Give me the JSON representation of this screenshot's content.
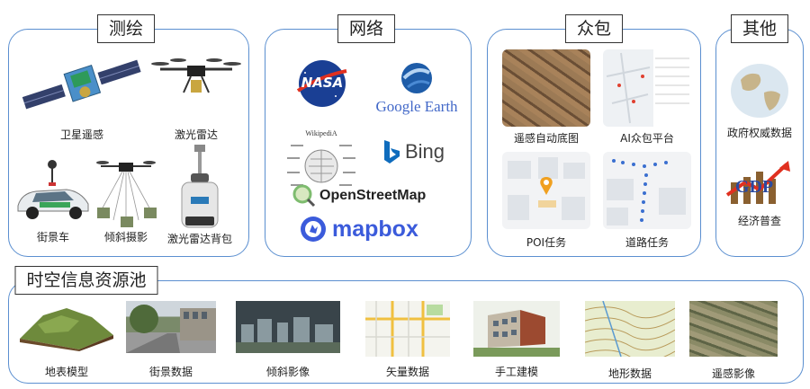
{
  "sections": {
    "survey": {
      "title": "测绘",
      "items": [
        "卫星遥感",
        "激光雷达",
        "街景车",
        "倾斜摄影",
        "激光雷达背包"
      ]
    },
    "network": {
      "title": "网络",
      "logos": {
        "nasa": "NASA",
        "google_earth": "Google Earth",
        "wikipedia": "WikipediA",
        "bing": "Bing",
        "osm": "OpenStreetMap",
        "mapbox": "mapbox"
      }
    },
    "crowd": {
      "title": "众包",
      "items": [
        "遥感自动底图",
        "AI众包平台",
        "POI任务",
        "道路任务"
      ]
    },
    "other": {
      "title": "其他",
      "items": [
        "政府权威数据",
        "经济普查"
      ],
      "gdp_text": "GDP"
    },
    "pool": {
      "title": "时空信息资源池",
      "items": [
        "地表模型",
        "街景数据",
        "倾斜影像",
        "矢量数据",
        "手工建模",
        "地形数据",
        "遥感影像"
      ]
    }
  },
  "colors": {
    "border": "#5b8fd0",
    "accent_red": "#e03020",
    "mapbox_blue": "#3b5bdb",
    "osm_green": "#7ebc6f",
    "bing_blue": "#0f6cbd"
  }
}
